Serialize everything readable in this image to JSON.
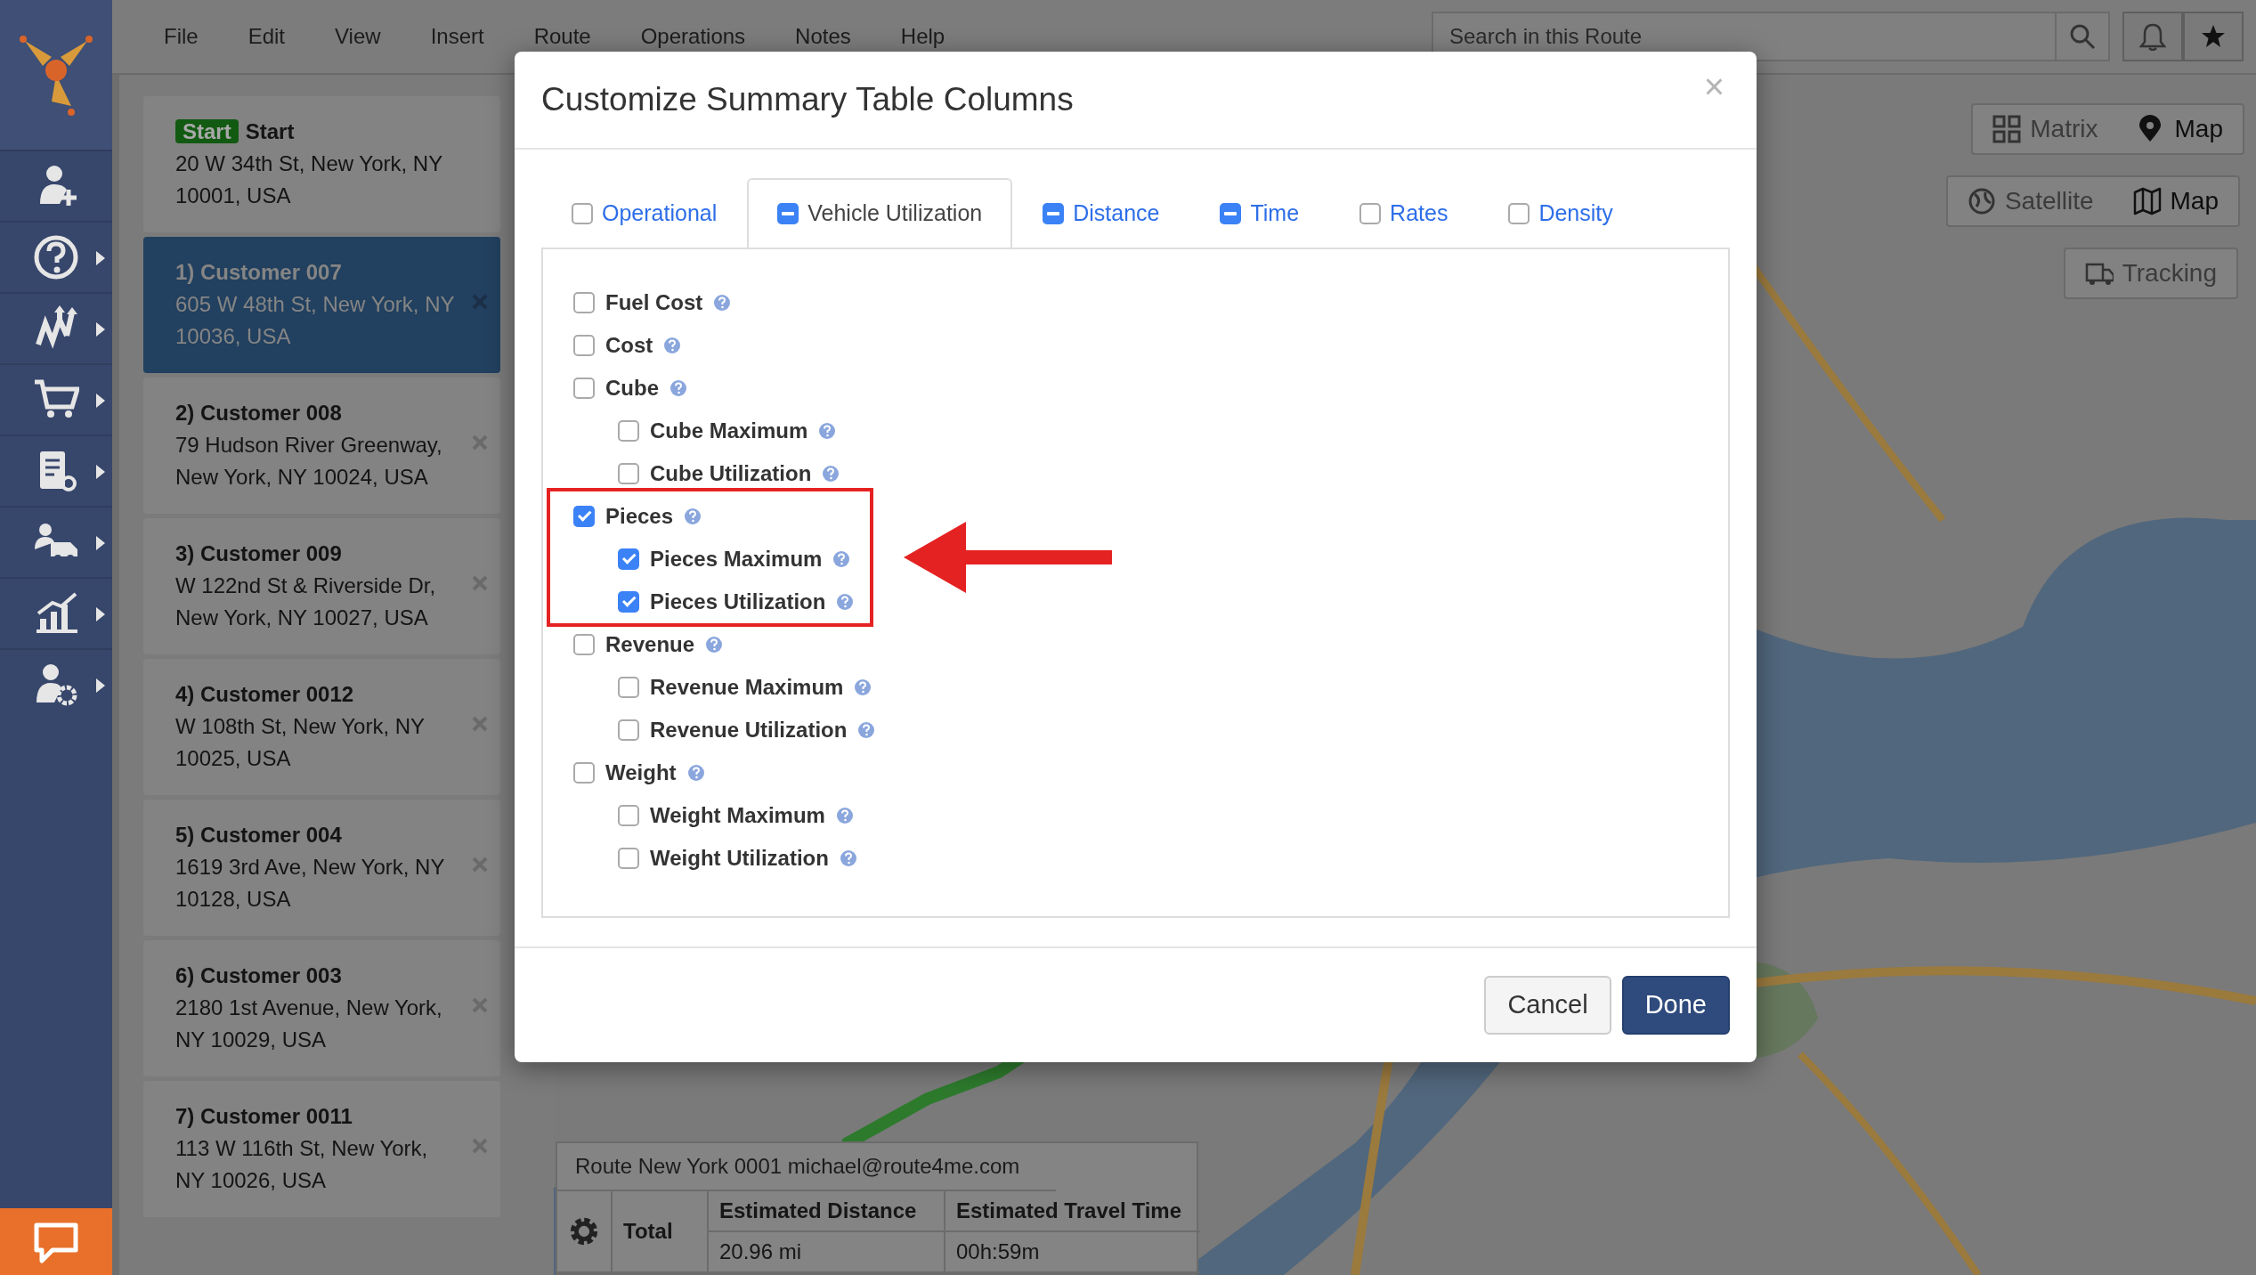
{
  "menu": [
    "File",
    "Edit",
    "View",
    "Insert",
    "Route",
    "Operations",
    "Notes",
    "Help"
  ],
  "search": {
    "placeholder": "Search in this Route"
  },
  "stops": [
    {
      "kind": "start",
      "badge": "Start",
      "title": "Start",
      "address_lines": [
        "20 W 34th St, New York, NY",
        "10001, USA"
      ],
      "selected": false
    },
    {
      "kind": "stop",
      "title": "1) Customer 007",
      "address_lines": [
        "605 W 48th St, New York, NY",
        "10036, USA"
      ],
      "selected": true
    },
    {
      "kind": "stop",
      "title": "2) Customer 008",
      "address_lines": [
        "79 Hudson River Greenway,",
        "New York, NY 10024, USA"
      ],
      "selected": false
    },
    {
      "kind": "stop",
      "title": "3) Customer 009",
      "address_lines": [
        "W 122nd St & Riverside Dr,",
        "New York, NY 10027, USA"
      ],
      "selected": false
    },
    {
      "kind": "stop",
      "title": "4) Customer 0012",
      "address_lines": [
        "W 108th St, New York, NY",
        "10025, USA"
      ],
      "selected": false
    },
    {
      "kind": "stop",
      "title": "5) Customer 004",
      "address_lines": [
        "1619 3rd Ave, New York, NY",
        "10128, USA"
      ],
      "selected": false
    },
    {
      "kind": "stop",
      "title": "6) Customer 003",
      "address_lines": [
        "2180 1st Avenue, New York,",
        "NY 10029, USA"
      ],
      "selected": false
    },
    {
      "kind": "stop",
      "title": "7) Customer 0011",
      "address_lines": [
        "113 W 116th St, New York,",
        "NY 10026, USA"
      ],
      "selected": false
    }
  ],
  "map_controls": [
    {
      "kind": "matrix",
      "items": [
        {
          "label": "Matrix",
          "selected": false
        },
        {
          "label": "Map",
          "selected": true
        }
      ]
    },
    {
      "kind": "layer",
      "items": [
        {
          "label": "Satellite",
          "selected": false
        },
        {
          "label": "Map",
          "selected": true
        }
      ]
    },
    {
      "kind": "tracking",
      "items": [
        {
          "label": "Tracking",
          "selected": false
        }
      ]
    }
  ],
  "route_summary": {
    "title": "Route New York 0001 michael@route4me.com",
    "row_label": "Total",
    "columns": [
      "Estimated Distance",
      "Estimated Travel Time"
    ],
    "values": [
      "20.96 mi",
      "00h:59m"
    ]
  },
  "dialog": {
    "title": "Customize Summary Table Columns",
    "close": "×",
    "tabs": [
      {
        "label": "Operational",
        "indeterminate": false,
        "selected": false
      },
      {
        "label": "Vehicle Utilization",
        "indeterminate": true,
        "selected": true
      },
      {
        "label": "Distance",
        "indeterminate": true,
        "selected": false
      },
      {
        "label": "Time",
        "indeterminate": true,
        "selected": false
      },
      {
        "label": "Rates",
        "indeterminate": false,
        "selected": false
      },
      {
        "label": "Density",
        "indeterminate": false,
        "selected": false
      }
    ],
    "options": [
      {
        "label": "Fuel Cost",
        "checked": false,
        "highlighted": false
      },
      {
        "label": "Cost",
        "checked": false,
        "highlighted": false
      },
      {
        "label": "Cube",
        "checked": false,
        "highlighted": false,
        "children": [
          {
            "label": "Cube Maximum",
            "checked": false
          },
          {
            "label": "Cube Utilization",
            "checked": false
          }
        ]
      },
      {
        "label": "Pieces",
        "checked": true,
        "highlighted": true,
        "children": [
          {
            "label": "Pieces Maximum",
            "checked": true
          },
          {
            "label": "Pieces Utilization",
            "checked": true
          }
        ]
      },
      {
        "label": "Revenue",
        "checked": false,
        "highlighted": false,
        "children": [
          {
            "label": "Revenue Maximum",
            "checked": false
          },
          {
            "label": "Revenue Utilization",
            "checked": false
          }
        ]
      },
      {
        "label": "Weight",
        "checked": false,
        "highlighted": false,
        "children": [
          {
            "label": "Weight Maximum",
            "checked": false
          },
          {
            "label": "Weight Utilization",
            "checked": false
          }
        ]
      }
    ],
    "buttons": [
      {
        "label": "Cancel",
        "kind": "secondary"
      },
      {
        "label": "Done",
        "kind": "primary"
      }
    ]
  }
}
